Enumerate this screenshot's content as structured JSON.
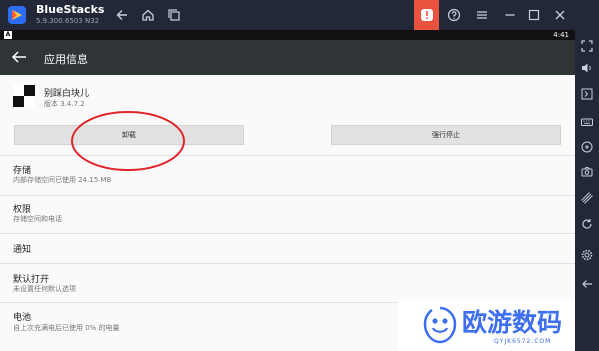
{
  "window": {
    "app_name": "BlueStacks",
    "version": "5.9.300.6503 N32"
  },
  "status_bar": {
    "time": "4:41",
    "left_icon_letter": "A"
  },
  "app_bar": {
    "title": "应用信息"
  },
  "app": {
    "name": "别踩白块儿",
    "version": "版本 3.4.7.2"
  },
  "buttons": {
    "uninstall": "卸载",
    "force_stop": "强行停止"
  },
  "sections": [
    {
      "title": "存储",
      "subtitle": "内部存储空间已使用 24.15 MB"
    },
    {
      "title": "权限",
      "subtitle": "存储空间和电话"
    },
    {
      "title": "通知",
      "subtitle": ""
    },
    {
      "title": "默认打开",
      "subtitle": "未设置任何默认选项"
    },
    {
      "title": "电池",
      "subtitle": "自上次充满电后已使用 0% 的电量"
    }
  ],
  "watermark": {
    "url": "QYJK6572.COM"
  },
  "colors": {
    "titlebar": "#232838",
    "alert": "#e9533f",
    "appbar": "#2f3537",
    "annotation": "#e0252a",
    "watermark_blue": "#3d6ff0"
  }
}
